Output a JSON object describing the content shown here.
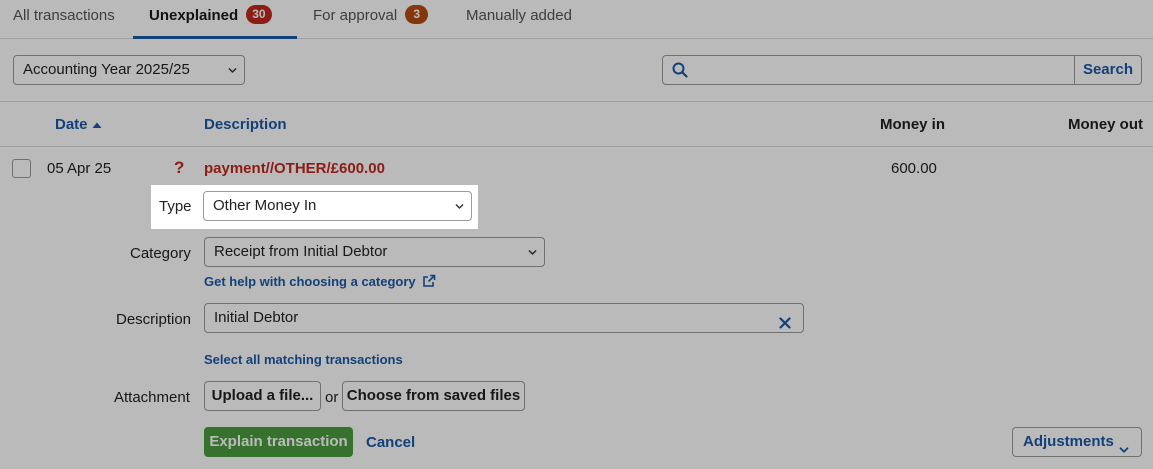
{
  "tabs": [
    {
      "label": "All transactions"
    },
    {
      "label": "Unexplained",
      "count": "30"
    },
    {
      "label": "For approval",
      "count": "3"
    },
    {
      "label": "Manually added"
    }
  ],
  "filters": {
    "period_select": "Accounting Year 2025/25",
    "search_placeholder": "",
    "search_button": "Search"
  },
  "columns": {
    "date": "Date",
    "description": "Description",
    "money_in": "Money in",
    "money_out": "Money out"
  },
  "transaction": {
    "date": "05 Apr 25",
    "status_icon": "?",
    "description": "payment//OTHER/£600.00",
    "money_in": "600.00",
    "money_out": ""
  },
  "form": {
    "type_label": "Type",
    "type_value": "Other Money In",
    "category_label": "Category",
    "category_value": "Receipt from Initial Debtor",
    "category_help": "Get help with choosing a category",
    "description_label": "Description",
    "description_value": "Initial Debtor",
    "select_matching": "Select all matching transactions",
    "attachment_label": "Attachment",
    "upload_button": "Upload a file...",
    "or_text": "or",
    "saved_files_button": "Choose from saved files",
    "explain_button": "Explain transaction",
    "cancel_link": "Cancel",
    "adjustments_button": "Adjustments"
  },
  "colors": {
    "accent": "#1a5aa8",
    "badge_unexplained": "#c0281e",
    "badge_approval": "#b84a10",
    "unexplained_text": "#c0281e",
    "primary_button": "#4a9d3f"
  },
  "icons": {
    "search": "search-icon",
    "sort": "sort-up-icon",
    "external": "external-link-icon",
    "clear": "close-icon",
    "dropdown": "chevron-down-icon"
  }
}
